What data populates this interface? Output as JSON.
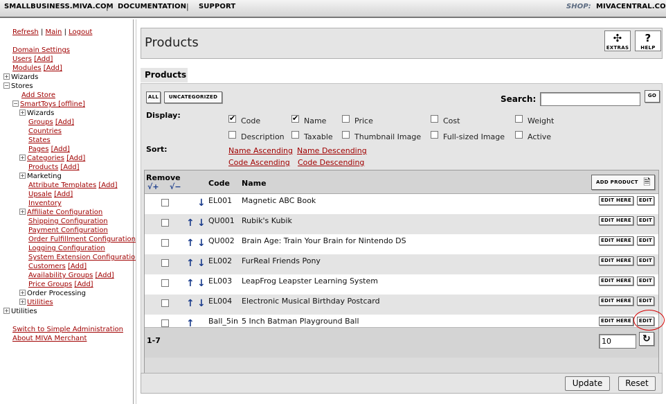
{
  "topbar": {
    "link1": "SMALLBUSINESS.MIVA.COM",
    "link2": "DOCUMENTATION",
    "link3": "SUPPORT",
    "sep": "|",
    "shop_label": "SHOP:",
    "shop_value": "MIVACENTRAL.COM"
  },
  "sidebar": {
    "refresh": "Refresh",
    "main": "Main",
    "logout": "Logout",
    "sep": "|",
    "domain_settings": "Domain Settings",
    "users": "Users",
    "modules": "Modules",
    "add": "[Add]",
    "wizards": "Wizards",
    "stores": "Stores",
    "add_store": "Add Store",
    "smarttoys": "SmartToys [offline]",
    "store_items": [
      {
        "label": "Wizards",
        "type": "plus"
      },
      {
        "label": "Groups",
        "type": "link",
        "add": true
      },
      {
        "label": "Countries",
        "type": "link"
      },
      {
        "label": "States",
        "type": "link"
      },
      {
        "label": "Pages",
        "type": "link",
        "add": true
      },
      {
        "label": "Categories",
        "type": "pluslink",
        "add": true
      },
      {
        "label": "Products",
        "type": "link",
        "add": true
      },
      {
        "label": "Marketing",
        "type": "plus"
      },
      {
        "label": "Attribute Templates",
        "type": "link",
        "add": true
      },
      {
        "label": "Upsale",
        "type": "link",
        "add": true
      },
      {
        "label": "Inventory",
        "type": "link"
      },
      {
        "label": "Affiliate Configuration",
        "type": "pluslink"
      },
      {
        "label": "Shipping Configuration",
        "type": "link"
      },
      {
        "label": "Payment Configuration",
        "type": "link"
      },
      {
        "label": "Order Fulfillment Configuration",
        "type": "link"
      },
      {
        "label": "Logging Configuration",
        "type": "link"
      },
      {
        "label": "System Extension Configuration",
        "type": "link"
      },
      {
        "label": "Customers",
        "type": "link",
        "add": true
      },
      {
        "label": "Availability Groups",
        "type": "link",
        "add": true
      },
      {
        "label": "Price Groups",
        "type": "link",
        "add": true
      },
      {
        "label": "Order Processing",
        "type": "plus"
      },
      {
        "label": "Utilities",
        "type": "pluslink"
      }
    ],
    "utilities": "Utilities",
    "switch": "Switch to Simple Administration",
    "about": "About MIVA Merchant"
  },
  "header": {
    "title": "Products",
    "extras": "EXTRAS",
    "help": "HELP",
    "extras_icon": "puzzle-icon",
    "help_icon": "question-icon"
  },
  "tab": {
    "label": "Products"
  },
  "filter": {
    "all": "ALL",
    "uncategorized": "UNCATEGORIZED",
    "search_label": "Search:",
    "search_value": "",
    "go": "GO"
  },
  "display": {
    "label": "Display:",
    "options": [
      {
        "label": "Code",
        "checked": true
      },
      {
        "label": "Name",
        "checked": true
      },
      {
        "label": "Price",
        "checked": false
      },
      {
        "label": "Cost",
        "checked": false
      },
      {
        "label": "Weight",
        "checked": false
      },
      {
        "label": "Description",
        "checked": false
      },
      {
        "label": "Taxable",
        "checked": false
      },
      {
        "label": "Thumbnail Image",
        "checked": false
      },
      {
        "label": "Full-sized Image",
        "checked": false
      },
      {
        "label": "Active",
        "checked": false
      }
    ]
  },
  "sort": {
    "label": "Sort:",
    "options": [
      "Name Ascending",
      "Name Descending",
      "Code Ascending",
      "Code Descending"
    ]
  },
  "table": {
    "headers": {
      "remove": "Remove",
      "check_all": "√+",
      "uncheck_all": "√−",
      "code": "Code",
      "name": "Name",
      "add_product": "ADD PRODUCT"
    },
    "edit_here": "EDIT HERE",
    "edit": "EDIT",
    "rows": [
      {
        "code": "EL001",
        "name": "Magnetic ABC Book",
        "up": false,
        "down": true
      },
      {
        "code": "QU001",
        "name": "Rubik's Kubik",
        "up": true,
        "down": true
      },
      {
        "code": "QU002",
        "name": "Brain Age: Train Your Brain for Nintendo DS",
        "up": true,
        "down": true
      },
      {
        "code": "EL002",
        "name": "FurReal Friends Pony",
        "up": true,
        "down": true
      },
      {
        "code": "EL003",
        "name": "LeapFrog Leapster Learning System",
        "up": true,
        "down": true
      },
      {
        "code": "EL004",
        "name": "Electronic Musical Birthday Postcard",
        "up": true,
        "down": true
      },
      {
        "code": "Ball_5in",
        "name": "5 Inch Batman Playground Ball",
        "up": true,
        "down": false
      }
    ],
    "range": "1-7",
    "per_page": "10"
  },
  "actions": {
    "update": "Update",
    "reset": "Reset"
  }
}
